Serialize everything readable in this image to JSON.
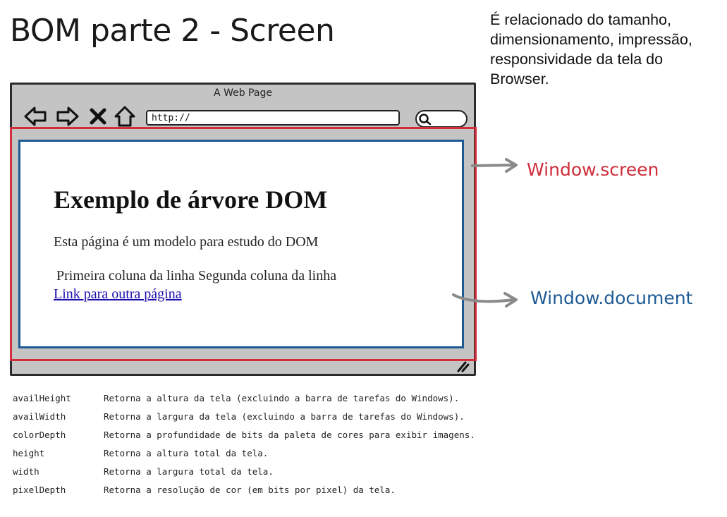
{
  "title": "BOM parte 2 - Screen",
  "description": "É relacionado do tamanho, dimensionamento, impressão, responsividade da tela do Browser.",
  "browser": {
    "window_title": "A Web Page",
    "address_text": "http://",
    "nav_icons": [
      "back-arrow-icon",
      "forward-arrow-icon",
      "close-x-icon",
      "home-icon"
    ],
    "search_icon": "search-icon"
  },
  "document": {
    "heading": "Exemplo de árvore DOM",
    "paragraph": "Esta página é um modelo para estudo do DOM",
    "cells": "Primeira coluna da linha Segunda coluna da linha",
    "link": "Link para outra página"
  },
  "labels": {
    "screen": "Window.screen",
    "document": "Window.document"
  },
  "colors": {
    "screen": "#d22f3c",
    "document": "#1d5a94",
    "browser_frame": "#c4c4c4"
  },
  "properties": [
    {
      "name": "availHeight",
      "description": "Retorna a altura da tela (excluindo a barra de tarefas do Windows)."
    },
    {
      "name": "availWidth",
      "description": "Retorna a largura da tela (excluindo a barra de tarefas do Windows)."
    },
    {
      "name": "colorDepth",
      "description": "Retorna a profundidade de bits da paleta de cores para exibir imagens."
    },
    {
      "name": "height",
      "description": "Retorna a altura total da tela."
    },
    {
      "name": "width",
      "description": "Retorna a largura total da tela."
    },
    {
      "name": "pixelDepth",
      "description": "Retorna a resolução de cor (em bits por pixel) da tela."
    }
  ]
}
